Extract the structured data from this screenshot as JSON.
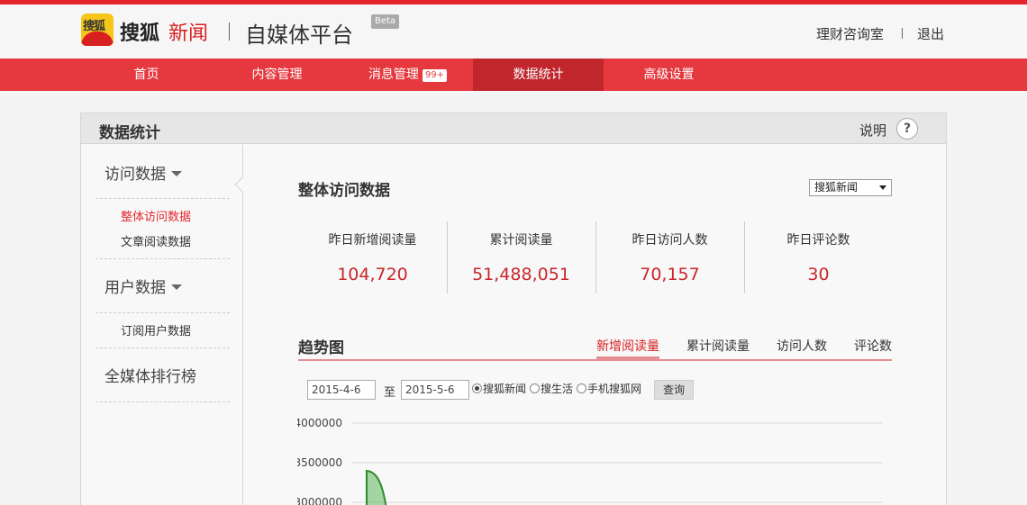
{
  "header": {
    "logo_text": "搜狐",
    "brand_name": "搜狐",
    "brand_news": "新闻",
    "platform_title": "自媒体平台",
    "beta": "Beta",
    "link_consult": "理财咨询室",
    "link_logout": "退出"
  },
  "nav": {
    "items": [
      {
        "label": "首页"
      },
      {
        "label": "内容管理"
      },
      {
        "label": "消息管理",
        "badge": "99+"
      },
      {
        "label": "数据统计"
      },
      {
        "label": "高级设置"
      }
    ]
  },
  "panel": {
    "title": "数据统计",
    "help_label": "说明",
    "help_icon": "?"
  },
  "sidebar": {
    "group1": "访问数据",
    "group1_items": [
      "整体访问数据",
      "文章阅读数据"
    ],
    "group2": "用户数据",
    "group2_items": [
      "订阅用户数据"
    ],
    "group3": "全媒体排行榜"
  },
  "overview": {
    "title": "整体访问数据",
    "source_select": "搜狐新闻",
    "stats": [
      {
        "label": "昨日新增阅读量",
        "value": "104,720"
      },
      {
        "label": "累计阅读量",
        "value": "51,488,051"
      },
      {
        "label": "昨日访问人数",
        "value": "70,157"
      },
      {
        "label": "昨日评论数",
        "value": "30"
      }
    ]
  },
  "trend": {
    "title": "趋势图",
    "tabs": [
      "新增阅读量",
      "累计阅读量",
      "访问人数",
      "评论数"
    ],
    "date_from": "2015-4-6",
    "to_label": "至",
    "date_to": "2015-5-6",
    "radios": [
      {
        "label": "搜狐新闻",
        "checked": true
      },
      {
        "label": "搜生活",
        "checked": false
      },
      {
        "label": "手机搜狐网",
        "checked": false
      }
    ],
    "query_button": "查询"
  },
  "chart_data": {
    "type": "area",
    "y_ticks": [
      "4000000",
      "3500000",
      "3000000"
    ],
    "ylim": [
      3000000,
      4000000
    ],
    "series_color": "#5cb85c"
  },
  "colors": {
    "brand_red": "#e4262c",
    "value_red": "#c9262c"
  }
}
